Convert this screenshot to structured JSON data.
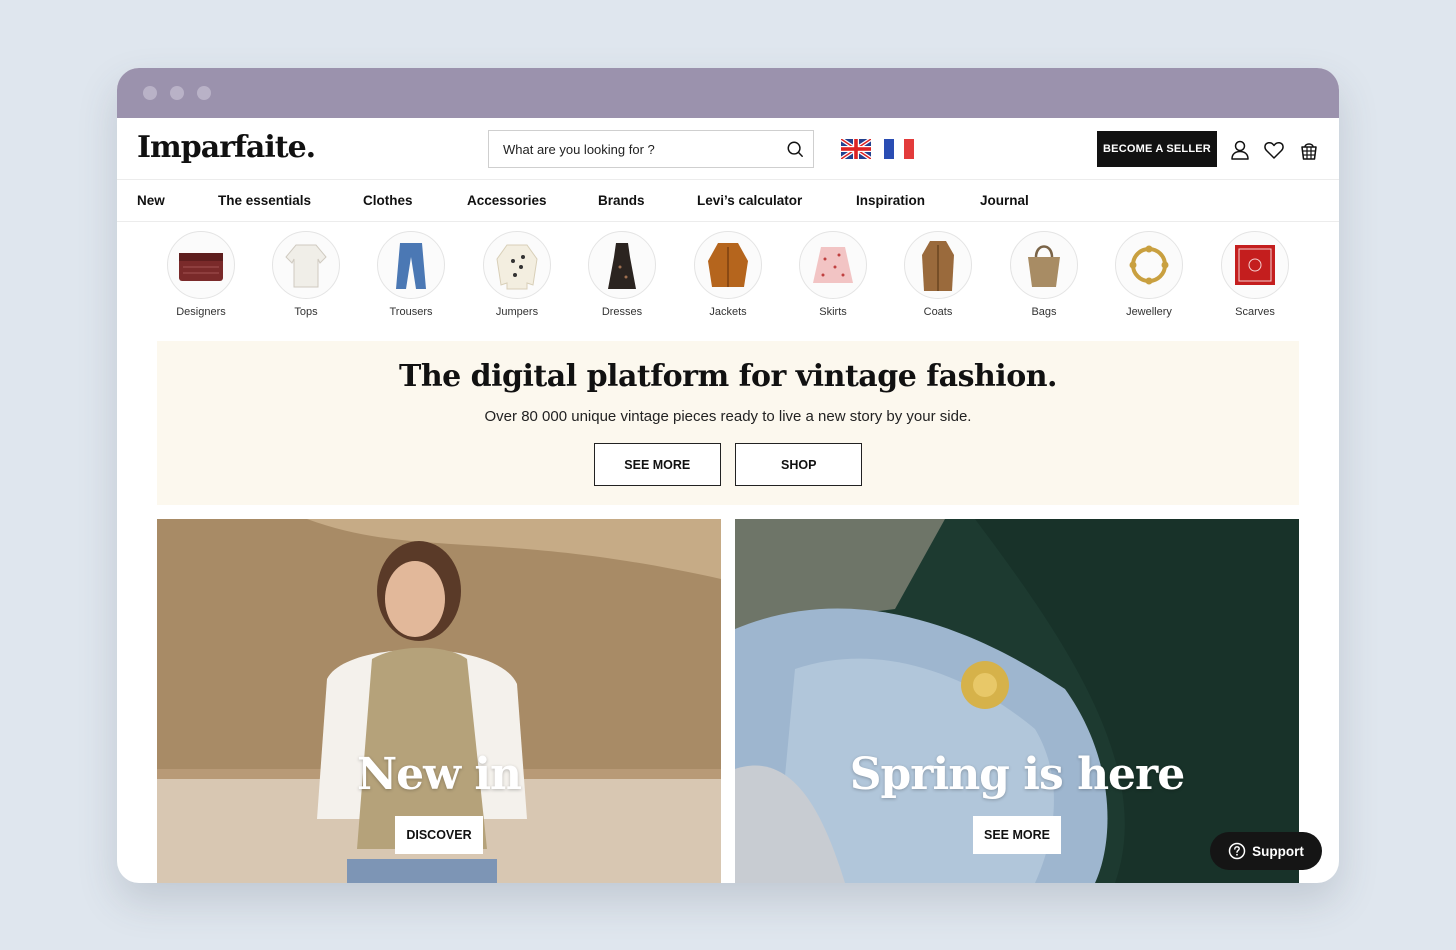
{
  "header": {
    "logo": "Imparfaite.",
    "search_placeholder": "What are you looking for ?",
    "languages": [
      "uk-flag-icon",
      "fr-flag-icon"
    ],
    "become_seller": "BECOME A SELLER",
    "icons": [
      "user-icon",
      "heart-icon",
      "basket-icon"
    ]
  },
  "nav": {
    "items": [
      {
        "label": "New"
      },
      {
        "label": "The essentials"
      },
      {
        "label": "Clothes"
      },
      {
        "label": "Accessories"
      },
      {
        "label": "Brands"
      },
      {
        "label": "Levi’s calculator"
      },
      {
        "label": "Inspiration"
      },
      {
        "label": "Journal"
      }
    ]
  },
  "categories": [
    {
      "label": "Designers"
    },
    {
      "label": "Tops"
    },
    {
      "label": "Trousers"
    },
    {
      "label": "Jumpers"
    },
    {
      "label": "Dresses"
    },
    {
      "label": "Jackets"
    },
    {
      "label": "Skirts"
    },
    {
      "label": "Coats"
    },
    {
      "label": "Bags"
    },
    {
      "label": "Jewellery"
    },
    {
      "label": "Scarves"
    }
  ],
  "hero": {
    "title": "The digital platform for vintage fashion.",
    "subtitle": "Over 80 000 unique vintage pieces ready to live a new story by your side.",
    "see_more": "SEE MORE",
    "shop": "SHOP"
  },
  "promos": [
    {
      "title": "New in",
      "button": "DISCOVER"
    },
    {
      "title": "Spring is here",
      "button": "SEE MORE"
    }
  ],
  "support": {
    "label": "Support"
  },
  "colors": {
    "titlebar": "#9b92ad",
    "hero_bg": "#fcf8ee",
    "accent_dark": "#111111",
    "page_bg": "#dfe6ee"
  }
}
